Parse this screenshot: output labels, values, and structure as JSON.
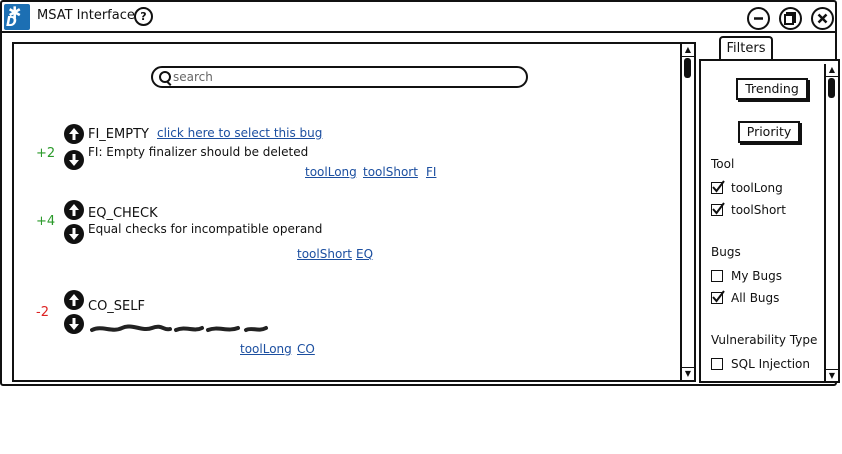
{
  "window": {
    "title": "MSAT Interface",
    "logo_letter": "D",
    "help_label": "?",
    "controls": [
      "minimize-icon",
      "restore-icon",
      "close-icon"
    ]
  },
  "search": {
    "placeholder": "search"
  },
  "bugs": [
    {
      "score": "+2",
      "name": "FI_EMPTY",
      "select_link": "click here to select this bug",
      "description": "FI: Empty finalizer should be deleted",
      "tags": [
        "toolLong",
        "toolShort",
        "FI"
      ]
    },
    {
      "score": "+4",
      "name": "EQ_CHECK",
      "description": "Equal checks for incompatible operand",
      "tags": [
        "toolShort",
        "EQ"
      ]
    },
    {
      "score": "-2",
      "name": "CO_SELF",
      "description": "",
      "tags": [
        "toolLong",
        "CO"
      ]
    }
  ],
  "filters": {
    "tab_label": "Filters",
    "trending_label": "Trending",
    "priority_label": "Priority",
    "tool_heading": "Tool",
    "tool_options": [
      {
        "label": "toolLong",
        "checked": true
      },
      {
        "label": "toolShort",
        "checked": true
      }
    ],
    "bugs_heading": "Bugs",
    "bugs_options": [
      {
        "label": "My Bugs",
        "checked": false
      },
      {
        "label": "All Bugs",
        "checked": true
      }
    ],
    "vuln_heading": "Vulnerability Type",
    "vuln_options": [
      {
        "label": "SQL Injection",
        "checked": false
      }
    ]
  },
  "colors": {
    "link": "#1c4fa0",
    "positive": "#2a9a2a",
    "negative": "#dd2222",
    "logo": "#1c6fb3"
  }
}
